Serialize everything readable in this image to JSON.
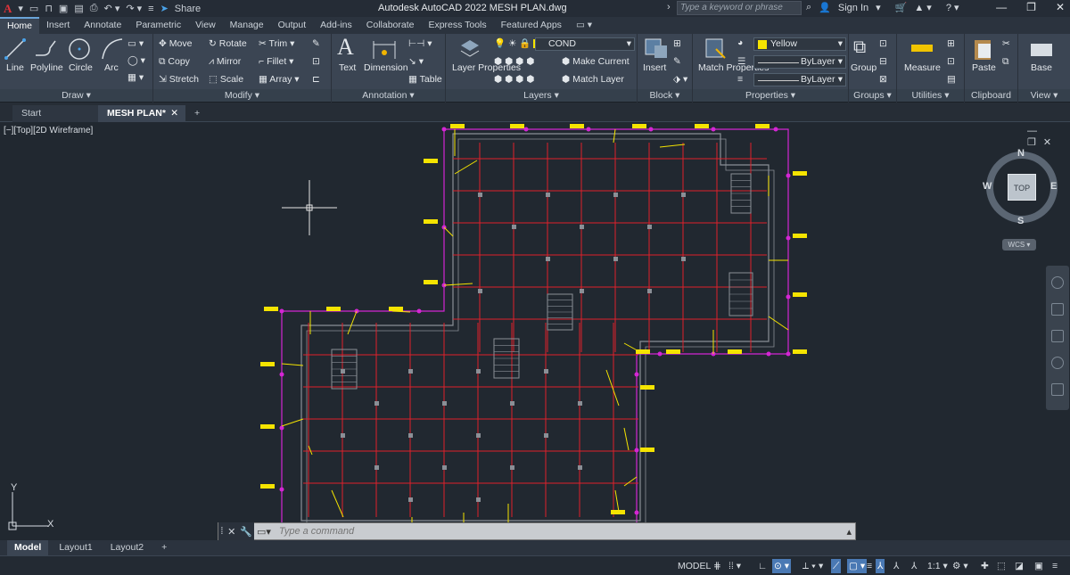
{
  "titlebar": {
    "app_letter": "A",
    "title": "Autodesk AutoCAD 2022    MESH PLAN.dwg",
    "share": "Share",
    "search_placeholder": "Type a keyword or phrase",
    "sign_in": "Sign In"
  },
  "ribbon_tabs": [
    "Home",
    "Insert",
    "Annotate",
    "Parametric",
    "View",
    "Manage",
    "Output",
    "Add-ins",
    "Collaborate",
    "Express Tools",
    "Featured Apps"
  ],
  "ribbon": {
    "draw": {
      "label": "Draw",
      "line": "Line",
      "polyline": "Polyline",
      "circle": "Circle",
      "arc": "Arc"
    },
    "modify": {
      "label": "Modify",
      "move": "Move",
      "rotate": "Rotate",
      "trim": "Trim",
      "copy": "Copy",
      "mirror": "Mirror",
      "fillet": "Fillet",
      "stretch": "Stretch",
      "scale": "Scale",
      "array": "Array"
    },
    "annotation": {
      "label": "Annotation",
      "text": "Text",
      "dimension": "Dimension",
      "table": "Table"
    },
    "layers": {
      "label": "Layers",
      "layer_properties": "Layer Properties",
      "current_layer": "COND",
      "make_current": "Make Current",
      "match_layer": "Match Layer"
    },
    "block": {
      "label": "Block",
      "insert": "Insert"
    },
    "properties": {
      "label": "Properties",
      "match_properties": "Match Properties",
      "color": "Yellow",
      "linetype": "ByLayer",
      "lineweight": "ByLayer"
    },
    "groups": {
      "label": "Groups",
      "group": "Group"
    },
    "utilities": {
      "label": "Utilities",
      "measure": "Measure"
    },
    "clipboard": {
      "label": "Clipboard",
      "paste": "Paste"
    },
    "view": {
      "label": "View",
      "base": "Base"
    }
  },
  "doc_tabs": {
    "start": "Start",
    "active": "MESH PLAN*"
  },
  "viewport": {
    "label": "[−][Top][2D Wireframe]"
  },
  "navcube": {
    "top": "TOP",
    "n": "N",
    "s": "S",
    "e": "E",
    "w": "W",
    "wcs": "WCS"
  },
  "ucs": {
    "x": "X",
    "y": "Y"
  },
  "command": {
    "placeholder": "Type a command"
  },
  "layout_tabs": [
    "Model",
    "Layout1",
    "Layout2"
  ],
  "status": {
    "model": "MODEL",
    "scale": "1:1"
  },
  "colors": {
    "grid": "#e0202a",
    "boundary": "#d426d4",
    "wall": "#8a8f96",
    "yellow": "#f5e400",
    "accent": "#4a79b4"
  }
}
